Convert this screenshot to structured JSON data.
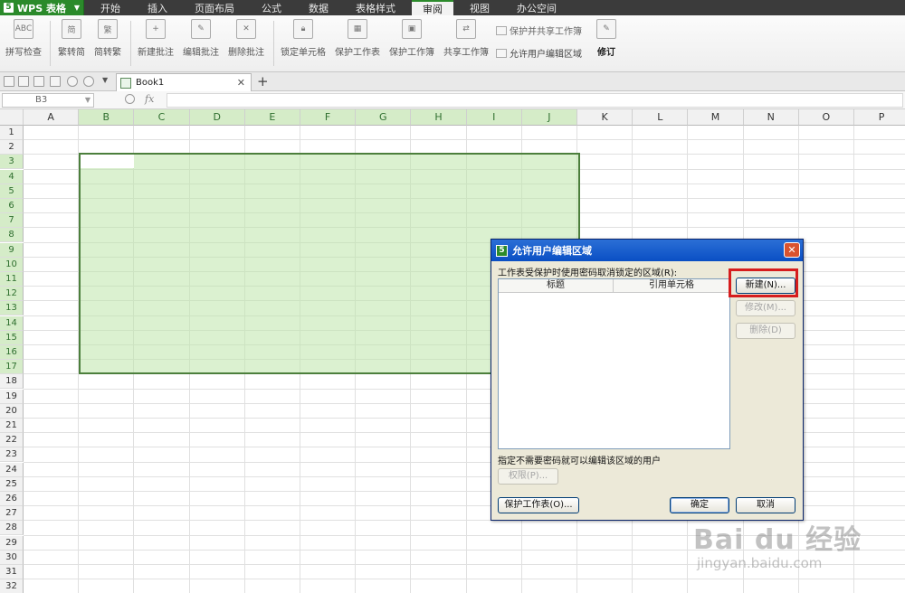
{
  "app": {
    "name": "WPS 表格",
    "logo_char": "5"
  },
  "menu": [
    "开始",
    "插入",
    "页面布局",
    "公式",
    "数据",
    "表格样式",
    "审阅",
    "视图",
    "办公空间"
  ],
  "active_menu": "审阅",
  "ribbon": {
    "spellcheck": "拼写检查",
    "trad_to_simp": "繁转简",
    "simp_to_trad": "简转繁",
    "new_comment": "新建批注",
    "edit_comment": "编辑批注",
    "delete_comment": "删除批注",
    "lock_cell": "锁定单元格",
    "protect_sheet": "保护工作表",
    "protect_book": "保护工作簿",
    "share_book": "共享工作簿",
    "protect_share": "保护并共享工作簿",
    "allow_edit_ranges": "允许用户编辑区域",
    "track_changes": "修订",
    "abc_label": "ABC"
  },
  "doc_tab": "Book1",
  "namebox": "B3",
  "fx_label": "fx",
  "columns": [
    "A",
    "B",
    "C",
    "D",
    "E",
    "F",
    "G",
    "H",
    "I",
    "J",
    "K",
    "L",
    "M",
    "N",
    "O",
    "P"
  ],
  "selected_columns": [
    "B",
    "C",
    "D",
    "E",
    "F",
    "G",
    "H",
    "I",
    "J"
  ],
  "rows": [
    "1",
    "2",
    "3",
    "4",
    "5",
    "6",
    "7",
    "8",
    "9",
    "10",
    "11",
    "12",
    "13",
    "14",
    "15",
    "16",
    "17",
    "18",
    "19",
    "20",
    "21",
    "22",
    "23",
    "24",
    "25",
    "26",
    "27",
    "28",
    "29",
    "30",
    "31",
    "32"
  ],
  "selected_rows": [
    "3",
    "4",
    "5",
    "6",
    "7",
    "8",
    "9",
    "10",
    "11",
    "12",
    "13",
    "14",
    "15",
    "16",
    "17"
  ],
  "dialog": {
    "title": "允许用户编辑区域",
    "description": "工作表受保护时使用密码取消锁定的区域(R):",
    "col_title": "标题",
    "col_ref": "引用单元格",
    "btn_new": "新建(N)...",
    "btn_modify": "修改(M)...",
    "btn_delete": "删除(D)",
    "users_label": "指定不需要密码就可以编辑该区域的用户",
    "btn_permissions": "权限(P)...",
    "btn_protect": "保护工作表(O)...",
    "btn_ok": "确定",
    "btn_cancel": "取消"
  },
  "watermark": {
    "brand": "Bai du 经验",
    "url": "jingyan.baidu.com"
  },
  "colors": {
    "accent_green": "#2b8a2b",
    "selection_fill": "#d5ecc8",
    "highlight_red": "#d61d1d"
  }
}
